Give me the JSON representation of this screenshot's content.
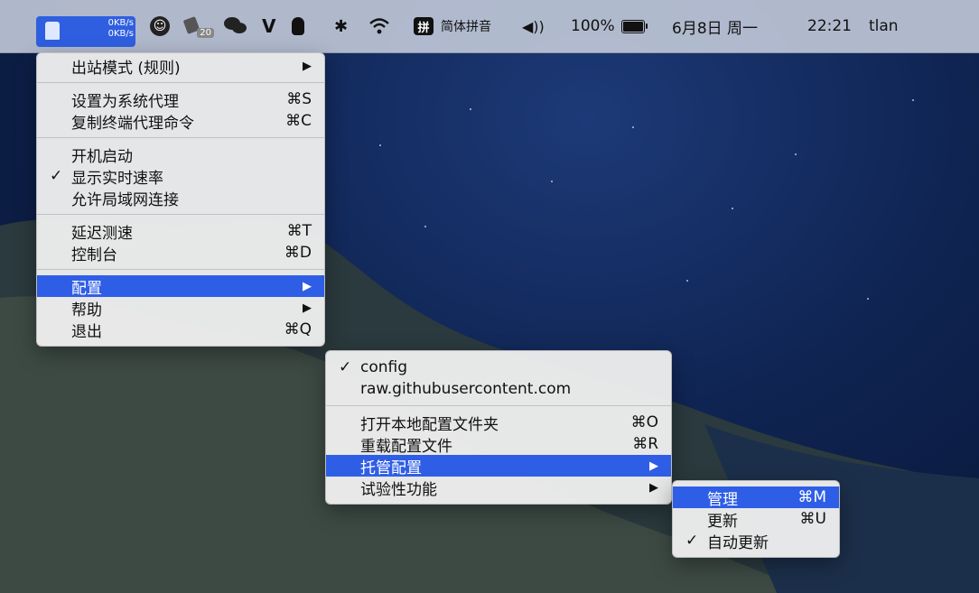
{
  "menubar": {
    "speed_up": "0KB/s",
    "speed_down": "0KB/s",
    "badge_count": "20",
    "ime_icon_label": "拼",
    "ime_name": "简体拼音",
    "battery_percent": "100%",
    "battery_level": 1.0,
    "date": "6月8日 周一",
    "time": "22:21",
    "user": "tlan"
  },
  "main_menu": {
    "items": [
      {
        "label": "出站模式 (规则)",
        "shortcut": "▶",
        "checked": ""
      },
      {
        "label": "设置为系统代理",
        "shortcut": "⌘S",
        "checked": ""
      },
      {
        "label": "复制终端代理命令",
        "shortcut": "⌘C",
        "checked": ""
      },
      {
        "label": "开机启动",
        "shortcut": "",
        "checked": ""
      },
      {
        "label": "显示实时速率",
        "shortcut": "",
        "checked": "✓"
      },
      {
        "label": "允许局域网连接",
        "shortcut": "",
        "checked": ""
      },
      {
        "label": "延迟测速",
        "shortcut": "⌘T",
        "checked": ""
      },
      {
        "label": "控制台",
        "shortcut": "⌘D",
        "checked": ""
      },
      {
        "label": "配置",
        "shortcut": "▶",
        "checked": ""
      },
      {
        "label": "帮助",
        "shortcut": "▶",
        "checked": ""
      },
      {
        "label": "退出",
        "shortcut": "⌘Q",
        "checked": ""
      }
    ]
  },
  "config_menu": {
    "items": [
      {
        "label": "config",
        "shortcut": "",
        "checked": "✓"
      },
      {
        "label": "raw.githubusercontent.com",
        "shortcut": "",
        "checked": ""
      },
      {
        "label": "打开本地配置文件夹",
        "shortcut": "⌘O",
        "checked": ""
      },
      {
        "label": "重载配置文件",
        "shortcut": "⌘R",
        "checked": ""
      },
      {
        "label": "托管配置",
        "shortcut": "▶",
        "checked": ""
      },
      {
        "label": "试验性功能",
        "shortcut": "▶",
        "checked": ""
      }
    ]
  },
  "managed_menu": {
    "items": [
      {
        "label": "管理",
        "shortcut": "⌘M",
        "checked": ""
      },
      {
        "label": "更新",
        "shortcut": "⌘U",
        "checked": ""
      },
      {
        "label": "自动更新",
        "shortcut": "",
        "checked": "✓"
      }
    ]
  }
}
